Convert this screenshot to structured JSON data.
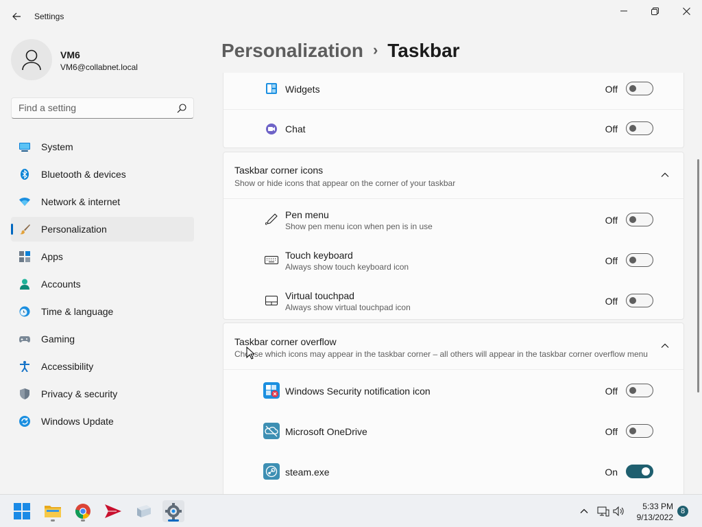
{
  "window": {
    "title": "Settings"
  },
  "user": {
    "name": "VM6",
    "email": "VM6@collabnet.local"
  },
  "search": {
    "placeholder": "Find a setting"
  },
  "nav": {
    "items": [
      {
        "label": "System",
        "icon": "monitor-icon"
      },
      {
        "label": "Bluetooth & devices",
        "icon": "bluetooth-icon"
      },
      {
        "label": "Network & internet",
        "icon": "wifi-icon"
      },
      {
        "label": "Personalization",
        "icon": "brush-icon",
        "active": true
      },
      {
        "label": "Apps",
        "icon": "apps-icon"
      },
      {
        "label": "Accounts",
        "icon": "person-icon"
      },
      {
        "label": "Time & language",
        "icon": "clock-globe-icon"
      },
      {
        "label": "Gaming",
        "icon": "gamepad-icon"
      },
      {
        "label": "Accessibility",
        "icon": "accessibility-icon"
      },
      {
        "label": "Privacy & security",
        "icon": "shield-icon"
      },
      {
        "label": "Windows Update",
        "icon": "update-icon"
      }
    ]
  },
  "breadcrumb": {
    "parent": "Personalization",
    "separator": "›",
    "current": "Taskbar"
  },
  "taskbar_items": {
    "widgets": {
      "title": "Widgets",
      "state": "Off"
    },
    "chat": {
      "title": "Chat",
      "state": "Off"
    }
  },
  "corner_icons": {
    "title": "Taskbar corner icons",
    "description": "Show or hide icons that appear on the corner of your taskbar",
    "items": [
      {
        "title": "Pen menu",
        "desc": "Show pen menu icon when pen is in use",
        "state": "Off"
      },
      {
        "title": "Touch keyboard",
        "desc": "Always show touch keyboard icon",
        "state": "Off"
      },
      {
        "title": "Virtual touchpad",
        "desc": "Always show virtual touchpad icon",
        "state": "Off"
      }
    ]
  },
  "corner_overflow": {
    "title": "Taskbar corner overflow",
    "description": "Choose which icons may appear in the taskbar corner – all others will appear in the taskbar corner overflow menu",
    "items": [
      {
        "title": "Windows Security notification icon",
        "state": "Off"
      },
      {
        "title": "Microsoft OneDrive",
        "state": "Off"
      },
      {
        "title": "steam.exe",
        "state": "On"
      }
    ]
  },
  "tray": {
    "time": "5:33 PM",
    "date": "9/13/2022",
    "notifications": "8"
  },
  "colors": {
    "accent": "#0067c0",
    "toggle_on": "#1f5f6f"
  }
}
